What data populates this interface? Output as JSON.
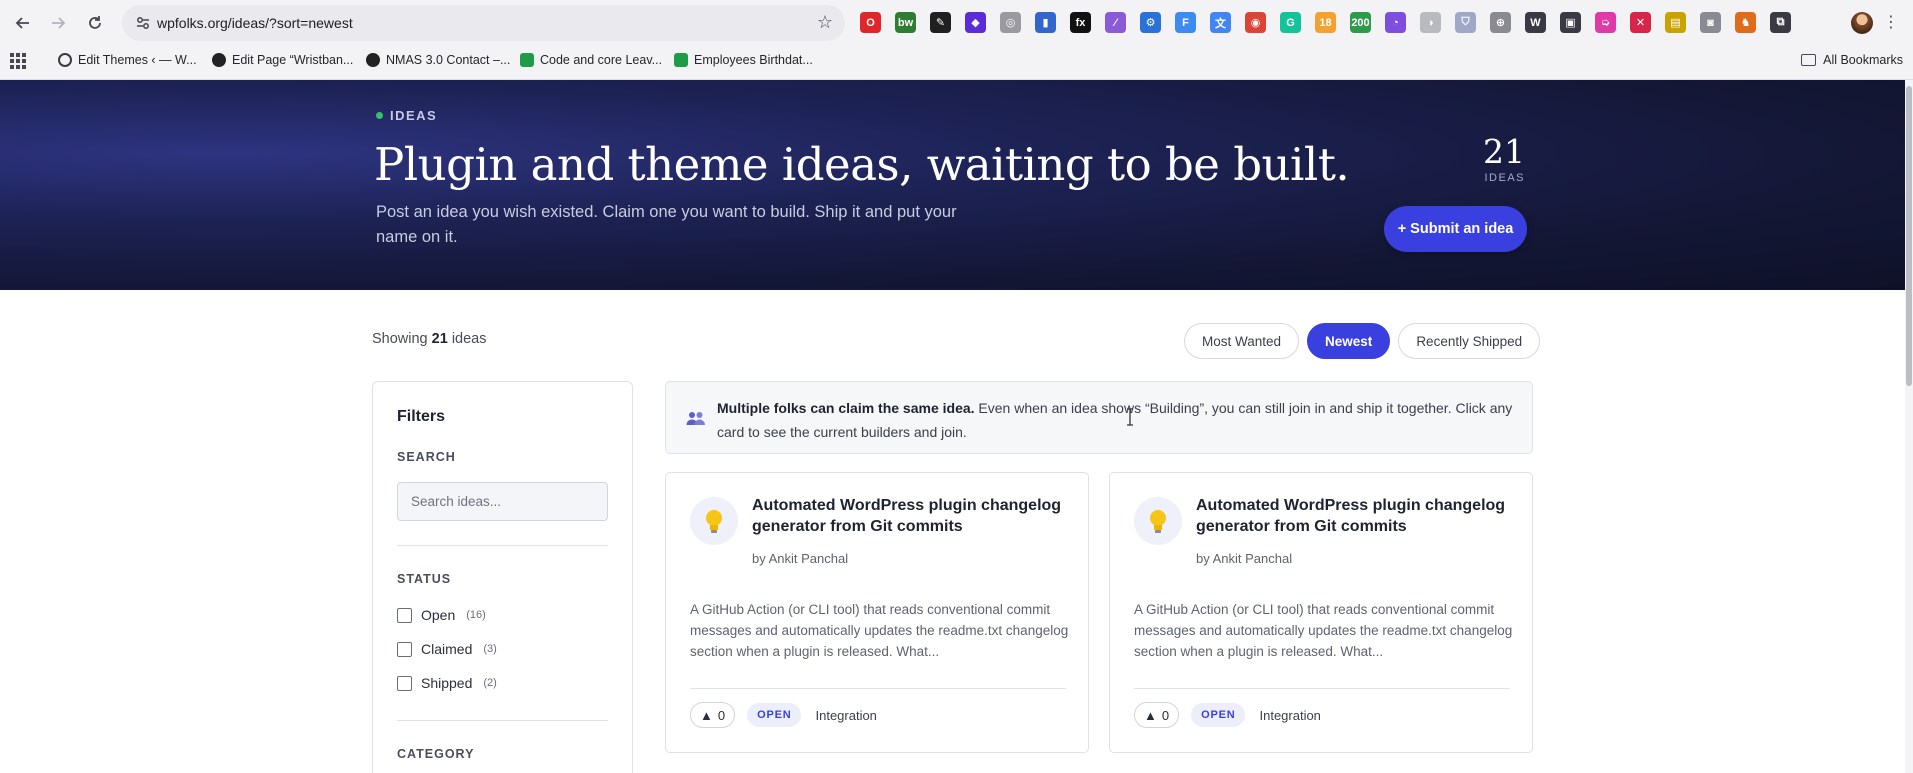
{
  "browser": {
    "url": "wpfolks.org/ideas/?sort=newest",
    "bookmarks": [
      {
        "label": "Edit Themes ‹ — W...",
        "color": "#3a3a44"
      },
      {
        "label": "Edit Page “Wristban...",
        "color": "#222222"
      },
      {
        "label": "NMAS 3.0 Contact –...",
        "color": "#222222"
      },
      {
        "label": "Code and core Leav...",
        "color": "#1e9c4a"
      },
      {
        "label": "Employees Birthdat...",
        "color": "#1e9c4a"
      }
    ],
    "all_bookmarks": "All Bookmarks",
    "extensions": [
      {
        "icon": "opera-icon",
        "color": "#e0262a",
        "glyph": "O"
      },
      {
        "icon": "bw-icon",
        "color": "#2f7d32",
        "glyph": "bw"
      },
      {
        "icon": "pen-icon",
        "color": "#202020",
        "glyph": "✎"
      },
      {
        "icon": "diamond-icon",
        "color": "#5b2bd8",
        "glyph": "◆"
      },
      {
        "icon": "compass-icon",
        "color": "#9a9aa0",
        "glyph": "◎"
      },
      {
        "icon": "bookmark-ext-icon",
        "color": "#3366cc",
        "glyph": "▮"
      },
      {
        "icon": "fx-icon",
        "color": "#111111",
        "glyph": "fx"
      },
      {
        "icon": "feather-icon",
        "color": "#8a5ad8",
        "glyph": "⁄"
      },
      {
        "icon": "gear-ext-icon",
        "color": "#2a72d8",
        "glyph": "⚙"
      },
      {
        "icon": "f-ext-icon",
        "color": "#3d8bf2",
        "glyph": "F"
      },
      {
        "icon": "translate-icon",
        "color": "#4285f4",
        "glyph": "文"
      },
      {
        "icon": "chrome-ext-icon",
        "color": "#db4437",
        "glyph": "◉"
      },
      {
        "icon": "grammarly-icon",
        "color": "#15c39a",
        "glyph": "G"
      },
      {
        "icon": "calendar-ext-icon",
        "color": "#f4a12f",
        "glyph": "18"
      },
      {
        "icon": "counter-ext-icon",
        "color": "#2e9b4a",
        "glyph": "200"
      },
      {
        "icon": "circle-ext-icon",
        "color": "#7d4ee0",
        "glyph": "◔"
      },
      {
        "icon": "moon-ext-icon",
        "color": "#b9b9c0",
        "glyph": "◑"
      },
      {
        "icon": "shield-ext-icon",
        "color": "#a0a8c8",
        "glyph": "⛉"
      },
      {
        "icon": "globe-ext-icon",
        "color": "#8a8a92",
        "glyph": "⊕"
      },
      {
        "icon": "wordpress-icon",
        "color": "#3a3a44",
        "glyph": "W"
      },
      {
        "icon": "screen-ext-icon",
        "color": "#3a3a44",
        "glyph": "▣"
      },
      {
        "icon": "arrow-ext-icon",
        "color": "#e03aa8",
        "glyph": "➭"
      },
      {
        "icon": "x-ext-icon",
        "color": "#d8264a",
        "glyph": "✕"
      },
      {
        "icon": "tag-ext-icon",
        "color": "#c9a400",
        "glyph": "▤"
      },
      {
        "icon": "camera-ext-icon",
        "color": "#8a8a92",
        "glyph": "◙"
      },
      {
        "icon": "chess-ext-icon",
        "color": "#e06b1a",
        "glyph": "♞"
      },
      {
        "icon": "puzzle-icon",
        "color": "#3a3a44",
        "glyph": "⧉"
      }
    ]
  },
  "hero": {
    "eyebrow": "IDEAS",
    "title": "Plugin and theme ideas, waiting to be built.",
    "subtitle": "Post an idea you wish existed. Claim one you want to build. Ship it and put your name on it.",
    "count": "21",
    "count_label": "IDEAS",
    "submit_label": "+ Submit an idea"
  },
  "listing": {
    "showing_prefix": "Showing ",
    "showing_count": "21",
    "showing_suffix": " ideas",
    "sort_options": [
      {
        "label": "Most Wanted",
        "active": false
      },
      {
        "label": "Newest",
        "active": true
      },
      {
        "label": "Recently Shipped",
        "active": false
      }
    ]
  },
  "filters": {
    "title": "Filters",
    "search_label": "SEARCH",
    "search_placeholder": "Search ideas...",
    "status_label": "STATUS",
    "statuses": [
      {
        "label": "Open",
        "count": "(16)"
      },
      {
        "label": "Claimed",
        "count": "(3)"
      },
      {
        "label": "Shipped",
        "count": "(2)"
      }
    ],
    "category_label": "CATEGORY"
  },
  "notice": {
    "bold": "Multiple folks can claim the same idea.",
    "text": " Even when an idea shows “Building”, you can still join in and ship it together. Click any card to see the current builders and join."
  },
  "cards": [
    {
      "title": "Automated WordPress plugin changelog generator from Git commits",
      "author": "by Ankit Panchal",
      "description": "A GitHub Action (or CLI tool) that reads conventional commit messages and automatically updates the readme.txt changelog section when a plugin is released. What...",
      "votes": "0",
      "status": "OPEN",
      "category": "Integration"
    },
    {
      "title": "Automated WordPress plugin changelog generator from Git commits",
      "author": "by Ankit Panchal",
      "description": "A GitHub Action (or CLI tool) that reads conventional commit messages and automatically updates the readme.txt changelog section when a plugin is released. What...",
      "votes": "0",
      "status": "OPEN",
      "category": "Integration"
    }
  ],
  "colors": {
    "accent": "#3a3fe0",
    "hero_bg": "#141735",
    "status_dot": "#33c266"
  }
}
